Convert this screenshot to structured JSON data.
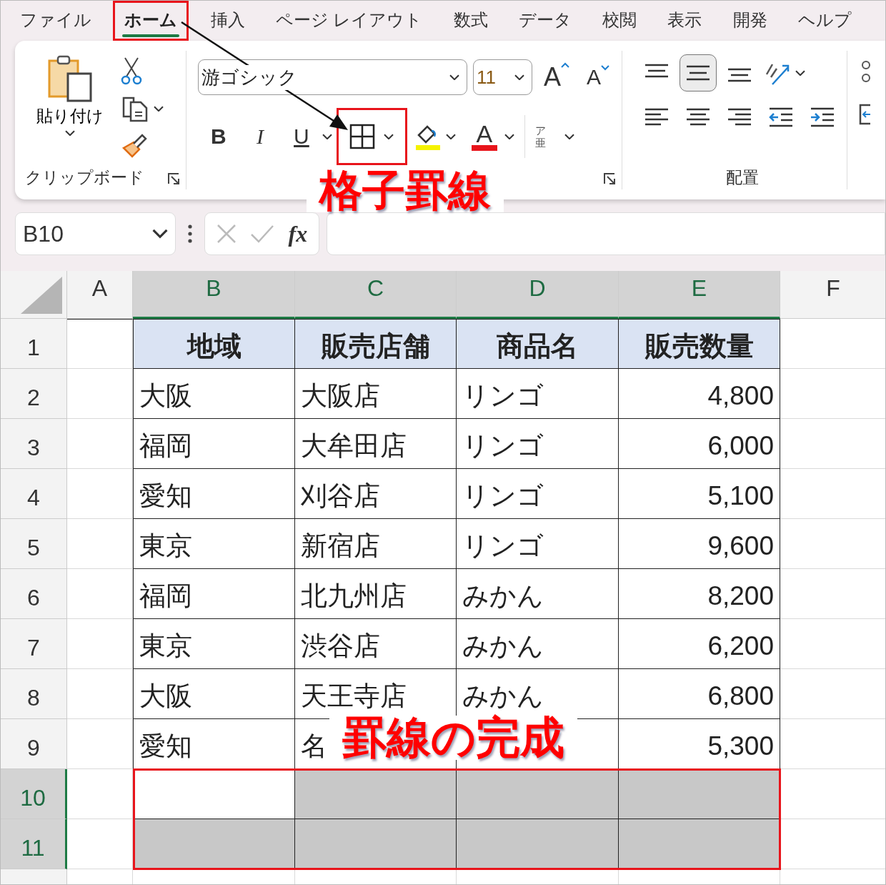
{
  "menu_tabs": [
    {
      "label": "ファイル",
      "selected": false,
      "boxed": false
    },
    {
      "label": "ホーム",
      "selected": true,
      "boxed": true
    },
    {
      "label": "挿入",
      "selected": false,
      "boxed": false
    },
    {
      "label": "ページ レイアウト",
      "selected": false,
      "boxed": false
    },
    {
      "label": "数式",
      "selected": false,
      "boxed": false
    },
    {
      "label": "データ",
      "selected": false,
      "boxed": false
    },
    {
      "label": "校閲",
      "selected": false,
      "boxed": false
    },
    {
      "label": "表示",
      "selected": false,
      "boxed": false
    },
    {
      "label": "開発",
      "selected": false,
      "boxed": false
    },
    {
      "label": "ヘルプ",
      "selected": false,
      "boxed": false
    }
  ],
  "ribbon": {
    "clipboard": {
      "paste_label": "貼り付け",
      "group_label": "クリップボード"
    },
    "font": {
      "font_name": "游ゴシック",
      "font_size": "11",
      "grow_label": "A",
      "shrink_label": "A",
      "bold_label": "B",
      "italic_label": "I",
      "underline_label": "U",
      "borders_boxed": true,
      "font_color_label": "A",
      "phonetic_top": "ア",
      "phonetic_bottom": "亜"
    },
    "alignment": {
      "vertical": [
        {
          "kind": "top",
          "selected": false
        },
        {
          "kind": "middle",
          "selected": true
        },
        {
          "kind": "bottom",
          "selected": false
        }
      ],
      "group_label": "配置"
    }
  },
  "formula_bar": {
    "name_box": "B10",
    "function_label": "fx"
  },
  "callouts": [
    "格子罫線",
    "罫線の完成"
  ],
  "sheet": {
    "columns": [
      {
        "label": "A",
        "selected": false
      },
      {
        "label": "B",
        "selected": true
      },
      {
        "label": "C",
        "selected": true
      },
      {
        "label": "D",
        "selected": true
      },
      {
        "label": "E",
        "selected": true
      },
      {
        "label": "F",
        "selected": false
      }
    ],
    "rows": [
      {
        "label": "1",
        "selected": false,
        "cells": [
          {
            "kind": "blank",
            "selected": false
          },
          {
            "kind": "heading",
            "text": "地域",
            "selected": false
          },
          {
            "kind": "heading",
            "text": "販売店舗",
            "selected": false
          },
          {
            "kind": "heading",
            "text": "商品名",
            "selected": false
          },
          {
            "kind": "heading",
            "text": "販売数量",
            "selected": false
          }
        ]
      },
      {
        "label": "2",
        "selected": false,
        "cells": [
          {
            "kind": "blank",
            "selected": false
          },
          {
            "kind": "text",
            "text": "大阪",
            "selected": false
          },
          {
            "kind": "text",
            "text": "大阪店",
            "selected": false
          },
          {
            "kind": "text",
            "text": "リンゴ",
            "selected": false
          },
          {
            "kind": "number",
            "text": "4,800",
            "selected": false
          }
        ]
      },
      {
        "label": "3",
        "selected": false,
        "cells": [
          {
            "kind": "blank",
            "selected": false
          },
          {
            "kind": "text",
            "text": "福岡",
            "selected": false
          },
          {
            "kind": "text",
            "text": "大牟田店",
            "selected": false
          },
          {
            "kind": "text",
            "text": "リンゴ",
            "selected": false
          },
          {
            "kind": "number",
            "text": "6,000",
            "selected": false
          }
        ]
      },
      {
        "label": "4",
        "selected": false,
        "cells": [
          {
            "kind": "blank",
            "selected": false
          },
          {
            "kind": "text",
            "text": "愛知",
            "selected": false
          },
          {
            "kind": "text",
            "text": "刈谷店",
            "selected": false
          },
          {
            "kind": "text",
            "text": "リンゴ",
            "selected": false
          },
          {
            "kind": "number",
            "text": "5,100",
            "selected": false
          }
        ]
      },
      {
        "label": "5",
        "selected": false,
        "cells": [
          {
            "kind": "blank",
            "selected": false
          },
          {
            "kind": "text",
            "text": "東京",
            "selected": false
          },
          {
            "kind": "text",
            "text": "新宿店",
            "selected": false
          },
          {
            "kind": "text",
            "text": "リンゴ",
            "selected": false
          },
          {
            "kind": "number",
            "text": "9,600",
            "selected": false
          }
        ]
      },
      {
        "label": "6",
        "selected": false,
        "cells": [
          {
            "kind": "blank",
            "selected": false
          },
          {
            "kind": "text",
            "text": "福岡",
            "selected": false
          },
          {
            "kind": "text",
            "text": "北九州店",
            "selected": false
          },
          {
            "kind": "text",
            "text": "みかん",
            "selected": false
          },
          {
            "kind": "number",
            "text": "8,200",
            "selected": false
          }
        ]
      },
      {
        "label": "7",
        "selected": false,
        "cells": [
          {
            "kind": "blank",
            "selected": false
          },
          {
            "kind": "text",
            "text": "東京",
            "selected": false
          },
          {
            "kind": "text",
            "text": "渋谷店",
            "selected": false
          },
          {
            "kind": "text",
            "text": "みかん",
            "selected": false
          },
          {
            "kind": "number",
            "text": "6,200",
            "selected": false
          }
        ]
      },
      {
        "label": "8",
        "selected": false,
        "cells": [
          {
            "kind": "blank",
            "selected": false
          },
          {
            "kind": "text",
            "text": "大阪",
            "selected": false
          },
          {
            "kind": "text",
            "text": "天王寺店",
            "selected": false
          },
          {
            "kind": "text",
            "text": "みかん",
            "selected": false
          },
          {
            "kind": "number",
            "text": "6,800",
            "selected": false
          }
        ]
      },
      {
        "label": "9",
        "selected": false,
        "cells": [
          {
            "kind": "blank",
            "selected": false
          },
          {
            "kind": "text",
            "text": "愛知",
            "selected": false
          },
          {
            "kind": "text",
            "text": "名",
            "selected": false
          },
          {
            "kind": "blank",
            "selected": false
          },
          {
            "kind": "number",
            "text": "5,300",
            "selected": false
          }
        ]
      },
      {
        "label": "10",
        "selected": true,
        "cells": [
          {
            "kind": "blank",
            "selected": false
          },
          {
            "kind": "blank",
            "selected": true,
            "active": true
          },
          {
            "kind": "blank",
            "selected": true
          },
          {
            "kind": "blank",
            "selected": true
          },
          {
            "kind": "blank",
            "selected": true
          }
        ]
      },
      {
        "label": "11",
        "selected": true,
        "cells": [
          {
            "kind": "blank",
            "selected": false
          },
          {
            "kind": "blank",
            "selected": true
          },
          {
            "kind": "blank",
            "selected": true
          },
          {
            "kind": "blank",
            "selected": true
          },
          {
            "kind": "blank",
            "selected": true
          }
        ]
      }
    ]
  }
}
